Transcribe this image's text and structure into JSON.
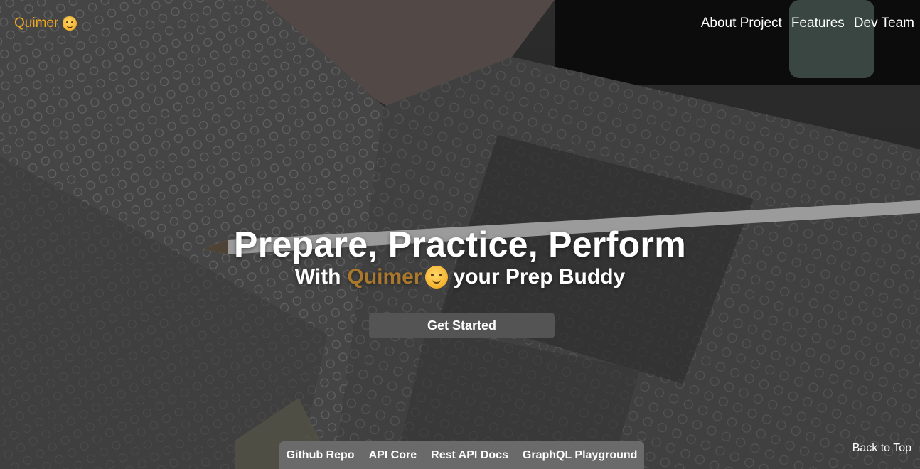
{
  "header": {
    "brand": "Quimer",
    "brand_icon": "hugging-face-emoji",
    "nav": [
      {
        "label": "About Project"
      },
      {
        "label": "Features"
      },
      {
        "label": "Dev Team"
      }
    ]
  },
  "hero": {
    "title": "Prepare, Practice, Perform",
    "subtitle_prefix": "With",
    "subtitle_brand": "Quimer",
    "subtitle_suffix": "your Prep Buddy",
    "cta_label": "Get Started"
  },
  "footer": {
    "links": [
      {
        "label": "Github Repo"
      },
      {
        "label": "API Core"
      },
      {
        "label": "Rest API Docs"
      },
      {
        "label": "GraphQL Playground"
      }
    ],
    "back_to_top": "Back to Top"
  },
  "colors": {
    "brand": "#f0a51e",
    "accent_dim": "#a9782c",
    "button_bg": "#545454",
    "links_bg": "#6a6a6a"
  }
}
